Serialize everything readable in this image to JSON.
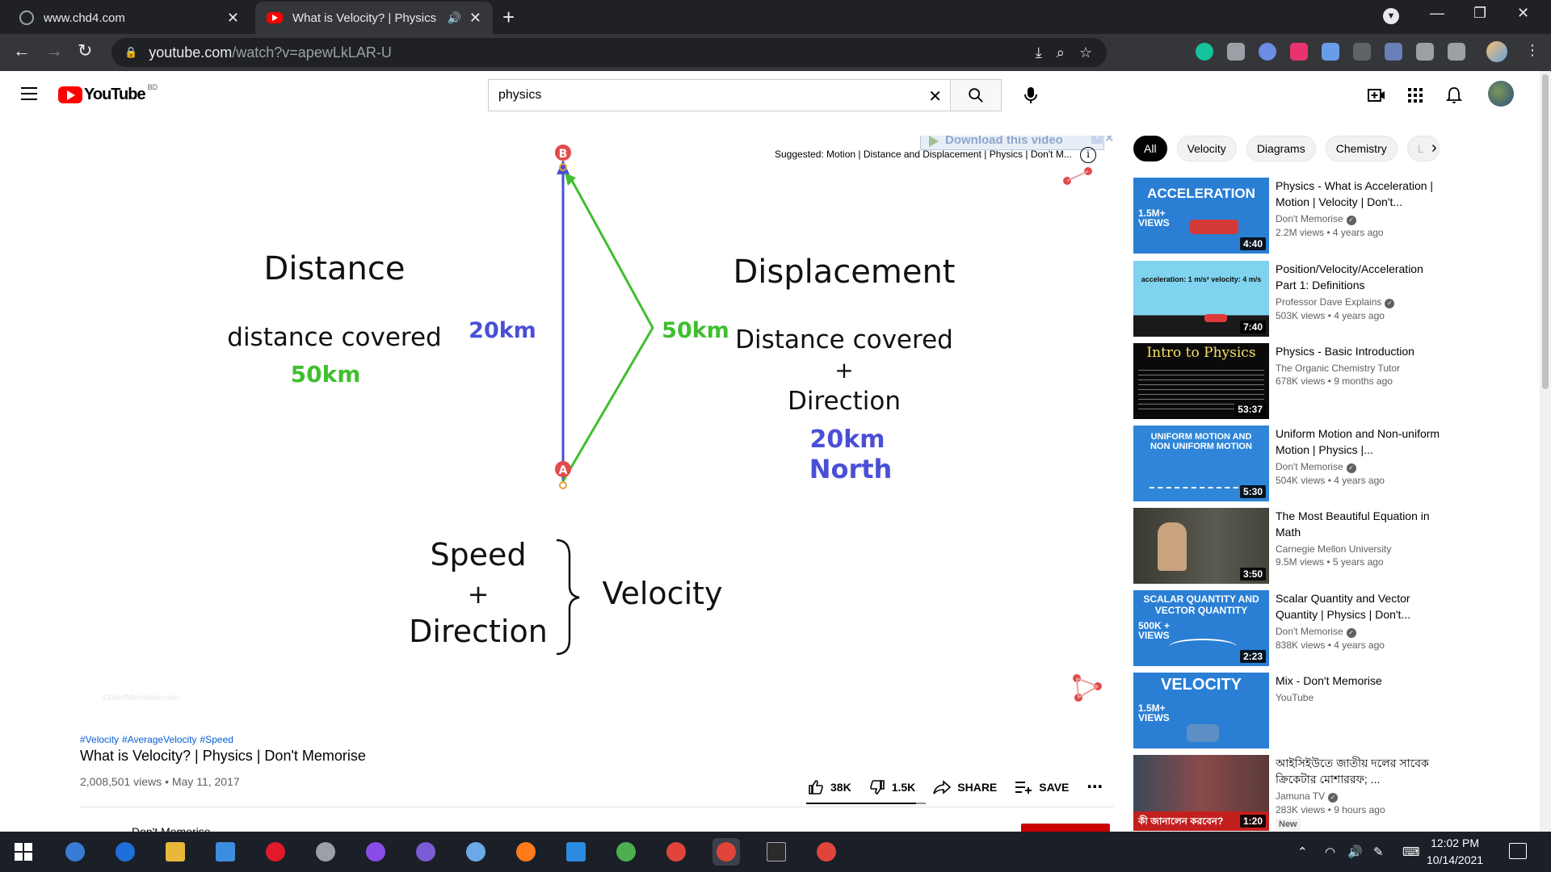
{
  "browser": {
    "tabs": [
      {
        "title": "www.chd4.com",
        "active": false
      },
      {
        "title": "What is Velocity? | Physics | Don't Memorise - YouTube",
        "active": true
      }
    ],
    "url_host": "youtube.com",
    "url_path": "/watch?v=apewLkLAR-U"
  },
  "youtube": {
    "logo_text": "YouTube",
    "country_code": "BD",
    "search_value": "physics",
    "search_placeholder": "Search"
  },
  "player": {
    "suggested": "Suggested: Motion | Distance and Displacement | Physics | Don't M...",
    "download_banner": "Download this video",
    "download_help": "?",
    "watermark": "©DontMemorise.com",
    "slide": {
      "distance_heading": "Distance",
      "distance_def": "distance covered",
      "distance_value": "50km",
      "displacement_heading": "Displacement",
      "displacement_def_1": "Distance covered",
      "displacement_plus": "+",
      "displacement_def_2": "Direction",
      "displacement_value": "20km",
      "displacement_dir": "North",
      "leg_straight": "20km",
      "leg_bent": "50km",
      "point_a": "A",
      "point_b": "B",
      "speed": "Speed",
      "plus": "+",
      "direction": "Direction",
      "velocity": "Velocity"
    }
  },
  "video": {
    "hashtags": [
      "#Velocity",
      "#AverageVelocity",
      "#Speed"
    ],
    "title": "What is Velocity? | Physics | Don't Memorise",
    "meta": "2,008,501 views • May 11, 2017",
    "likes": "38K",
    "dislikes": "1.5K",
    "share_label": "SHARE",
    "save_label": "SAVE",
    "like_ratio": 0.92,
    "channel": "Don't Memorise"
  },
  "chips": [
    "All",
    "Velocity",
    "Diagrams",
    "Chemistry",
    "L"
  ],
  "recommendations": [
    {
      "title": "Physics - What is Acceleration | Motion | Velocity | Don't...",
      "channel": "Don't Memorise",
      "verified": true,
      "stats": "2.2M views • 4 years ago",
      "duration": "4:40",
      "thumb_text": "ACCELERATION",
      "thumb_badge": "1.5M+ VIEWS",
      "color": "#2a7fd4"
    },
    {
      "title": "Position/Velocity/Acceleration Part 1: Definitions",
      "channel": "Professor Dave Explains",
      "verified": true,
      "stats": "503K views • 4 years ago",
      "duration": "7:40",
      "thumb_text": "acceleration: 1 m/s²   velocity: 4 m/s",
      "thumb_badge": "",
      "color": "#7fd3ee"
    },
    {
      "title": "Physics - Basic Introduction",
      "channel": "The Organic Chemistry Tutor",
      "verified": false,
      "stats": "678K views • 9 months ago",
      "duration": "53:37",
      "thumb_text": "Intro to Physics",
      "thumb_badge": "",
      "color": "#0a0a0a"
    },
    {
      "title": "Uniform Motion and Non-uniform Motion | Physics |...",
      "channel": "Don't Memorise",
      "verified": true,
      "stats": "504K views • 4 years ago",
      "duration": "5:30",
      "thumb_text": "UNIFORM MOTION AND NON UNIFORM MOTION",
      "thumb_badge": "",
      "color": "#2f86d8"
    },
    {
      "title": "The Most Beautiful Equation in Math",
      "channel": "Carnegie Mellon University",
      "verified": false,
      "stats": "9.5M views • 5 years ago",
      "duration": "3:50",
      "thumb_text": "",
      "thumb_badge": "",
      "color": "#4a4a42"
    },
    {
      "title": "Scalar Quantity and Vector Quantity | Physics | Don't...",
      "channel": "Don't Memorise",
      "verified": true,
      "stats": "838K views • 4 years ago",
      "duration": "2:23",
      "thumb_text": "SCALAR QUANTITY AND VECTOR QUANTITY",
      "thumb_badge": "500K + VIEWS",
      "color": "#2a7fd4"
    },
    {
      "title": "Mix - Don't Memorise",
      "channel": "YouTube",
      "verified": false,
      "stats": "",
      "duration": "",
      "thumb_text": "VELOCITY",
      "thumb_badge": "1.5M+ VIEWS",
      "color": "#2a7fd4"
    },
    {
      "title": "আইসিইউতে জাতীয় দলের সাবেক ক্রিকেটার মোশাররফ; ...",
      "channel": "Jamuna TV",
      "verified": true,
      "stats": "283K views • 9 hours ago",
      "duration": "1:20",
      "thumb_text": "কী জানালেন করবেন?",
      "thumb_badge": "",
      "color": "#6b3a3a",
      "new_badge": "New"
    }
  ],
  "taskbar": {
    "time": "12:02 PM",
    "date": "10/14/2021"
  }
}
